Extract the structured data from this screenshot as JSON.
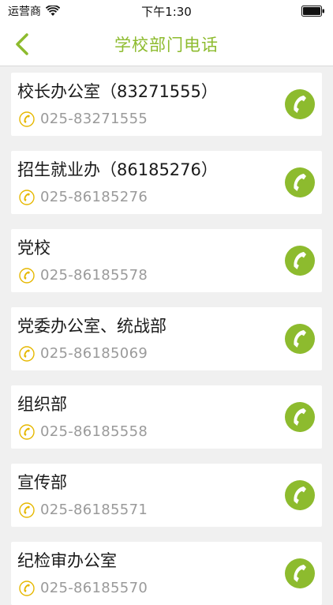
{
  "status_bar": {
    "carrier": "运营商",
    "time": "下午1:30"
  },
  "nav": {
    "title": "学校部门电话"
  },
  "colors": {
    "accent": "#8dbb2e",
    "icon_yellow": "#e6b800"
  },
  "departments": [
    {
      "name": "校长办公室（83271555）",
      "phone": "025-83271555"
    },
    {
      "name": "招生就业办（86185276）",
      "phone": "025-86185276"
    },
    {
      "name": "党校",
      "phone": "025-86185578"
    },
    {
      "name": "党委办公室、统战部",
      "phone": "025-86185069"
    },
    {
      "name": "组织部",
      "phone": "025-86185558"
    },
    {
      "name": "宣传部",
      "phone": "025-86185571"
    },
    {
      "name": "纪检审办公室",
      "phone": "025-86185570"
    }
  ]
}
